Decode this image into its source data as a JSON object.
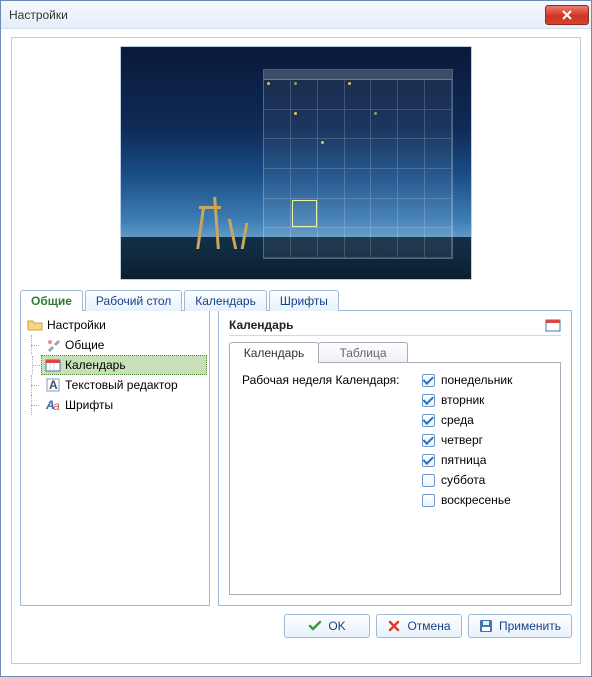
{
  "window": {
    "title": "Настройки"
  },
  "tabs": {
    "items": [
      {
        "label": "Общие"
      },
      {
        "label": "Рабочий стол"
      },
      {
        "label": "Календарь"
      },
      {
        "label": "Шрифты"
      }
    ]
  },
  "tree": {
    "root": "Настройки",
    "items": [
      {
        "label": "Общие"
      },
      {
        "label": "Календарь"
      },
      {
        "label": "Текстовый редактор"
      },
      {
        "label": "Шрифты"
      }
    ]
  },
  "section": {
    "title": "Календарь"
  },
  "subtabs": {
    "items": [
      {
        "label": "Календарь"
      },
      {
        "label": "Таблица"
      }
    ]
  },
  "form": {
    "weekLabel": "Рабочая неделя Календаря:",
    "days": [
      {
        "label": "понедельник",
        "checked": true
      },
      {
        "label": "вторник",
        "checked": true
      },
      {
        "label": "среда",
        "checked": true
      },
      {
        "label": "четверг",
        "checked": true
      },
      {
        "label": "пятница",
        "checked": true
      },
      {
        "label": "суббота",
        "checked": false
      },
      {
        "label": "воскресенье",
        "checked": false
      }
    ]
  },
  "buttons": {
    "ok": "OK",
    "cancel": "Отмена",
    "apply": "Применить"
  }
}
